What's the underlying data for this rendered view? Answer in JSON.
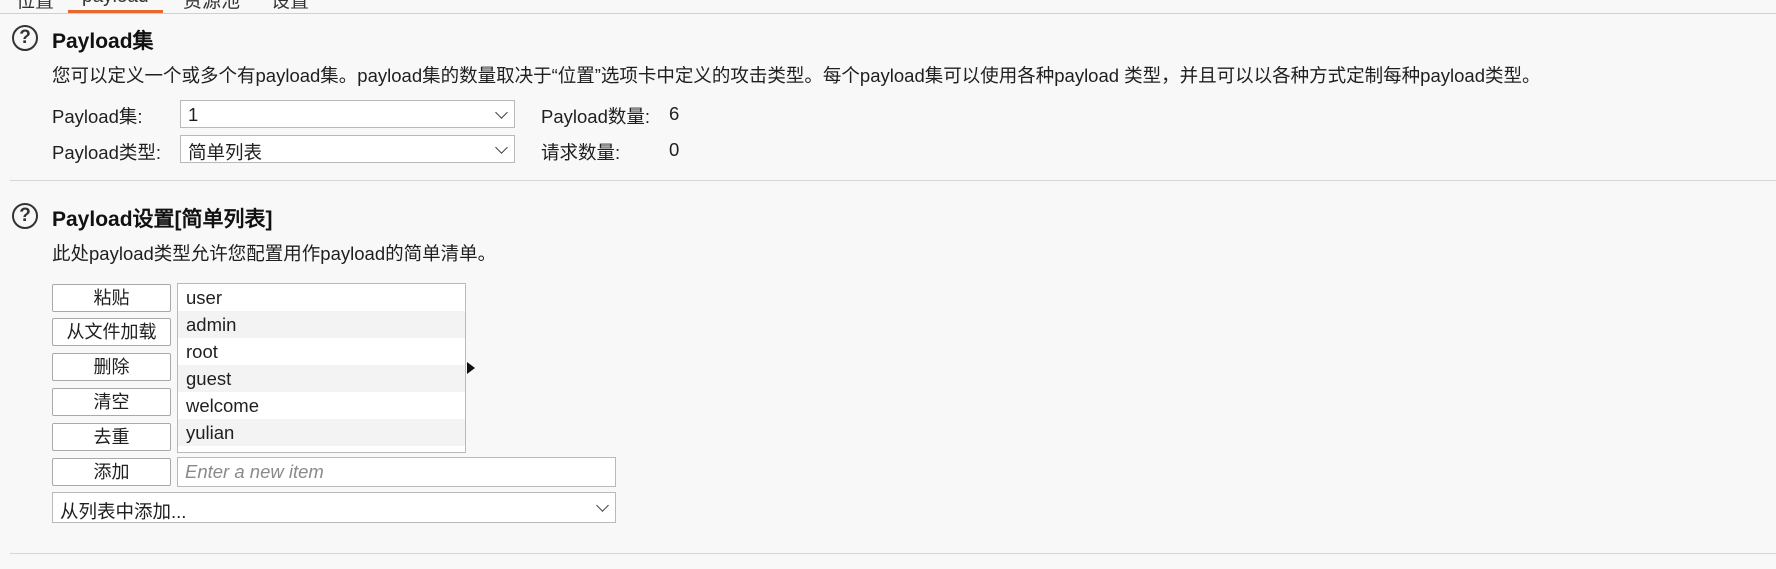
{
  "tabs": [
    "位置",
    "payload",
    "资源池",
    "设置"
  ],
  "payload_sets": {
    "title": "Payload集",
    "description": "您可以定义一个或多个有payload集。payload集的数量取决于“位置”选项卡中定义的攻击类型。每个payload集可以使用各种payload 类型，并且可以以各种方式定制每种payload类型。",
    "set_label": "Payload集:",
    "set_value": "1",
    "type_label": "Payload类型:",
    "type_value": "简单列表",
    "count_label": "Payload数量:",
    "count_value": "6",
    "requests_label": "请求数量:",
    "requests_value": "0"
  },
  "payload_settings": {
    "title": "Payload设置[简单列表]",
    "description": "此处payload类型允许您配置用作payload的简单清单。",
    "buttons": {
      "paste": "粘贴",
      "load": "从文件加载",
      "remove": "删除",
      "clear": "清空",
      "dedupe": "去重",
      "add": "添加"
    },
    "items": [
      "user",
      "admin",
      "root",
      "guest",
      "welcome",
      "yulian"
    ],
    "add_placeholder": "Enter a new item",
    "add_from_list": "从列表中添加..."
  },
  "icons": [
    "help-icon",
    "chevron-down-icon",
    "arrow-right-icon"
  ],
  "colors": {
    "active_tab_accent": "#e8672f"
  }
}
